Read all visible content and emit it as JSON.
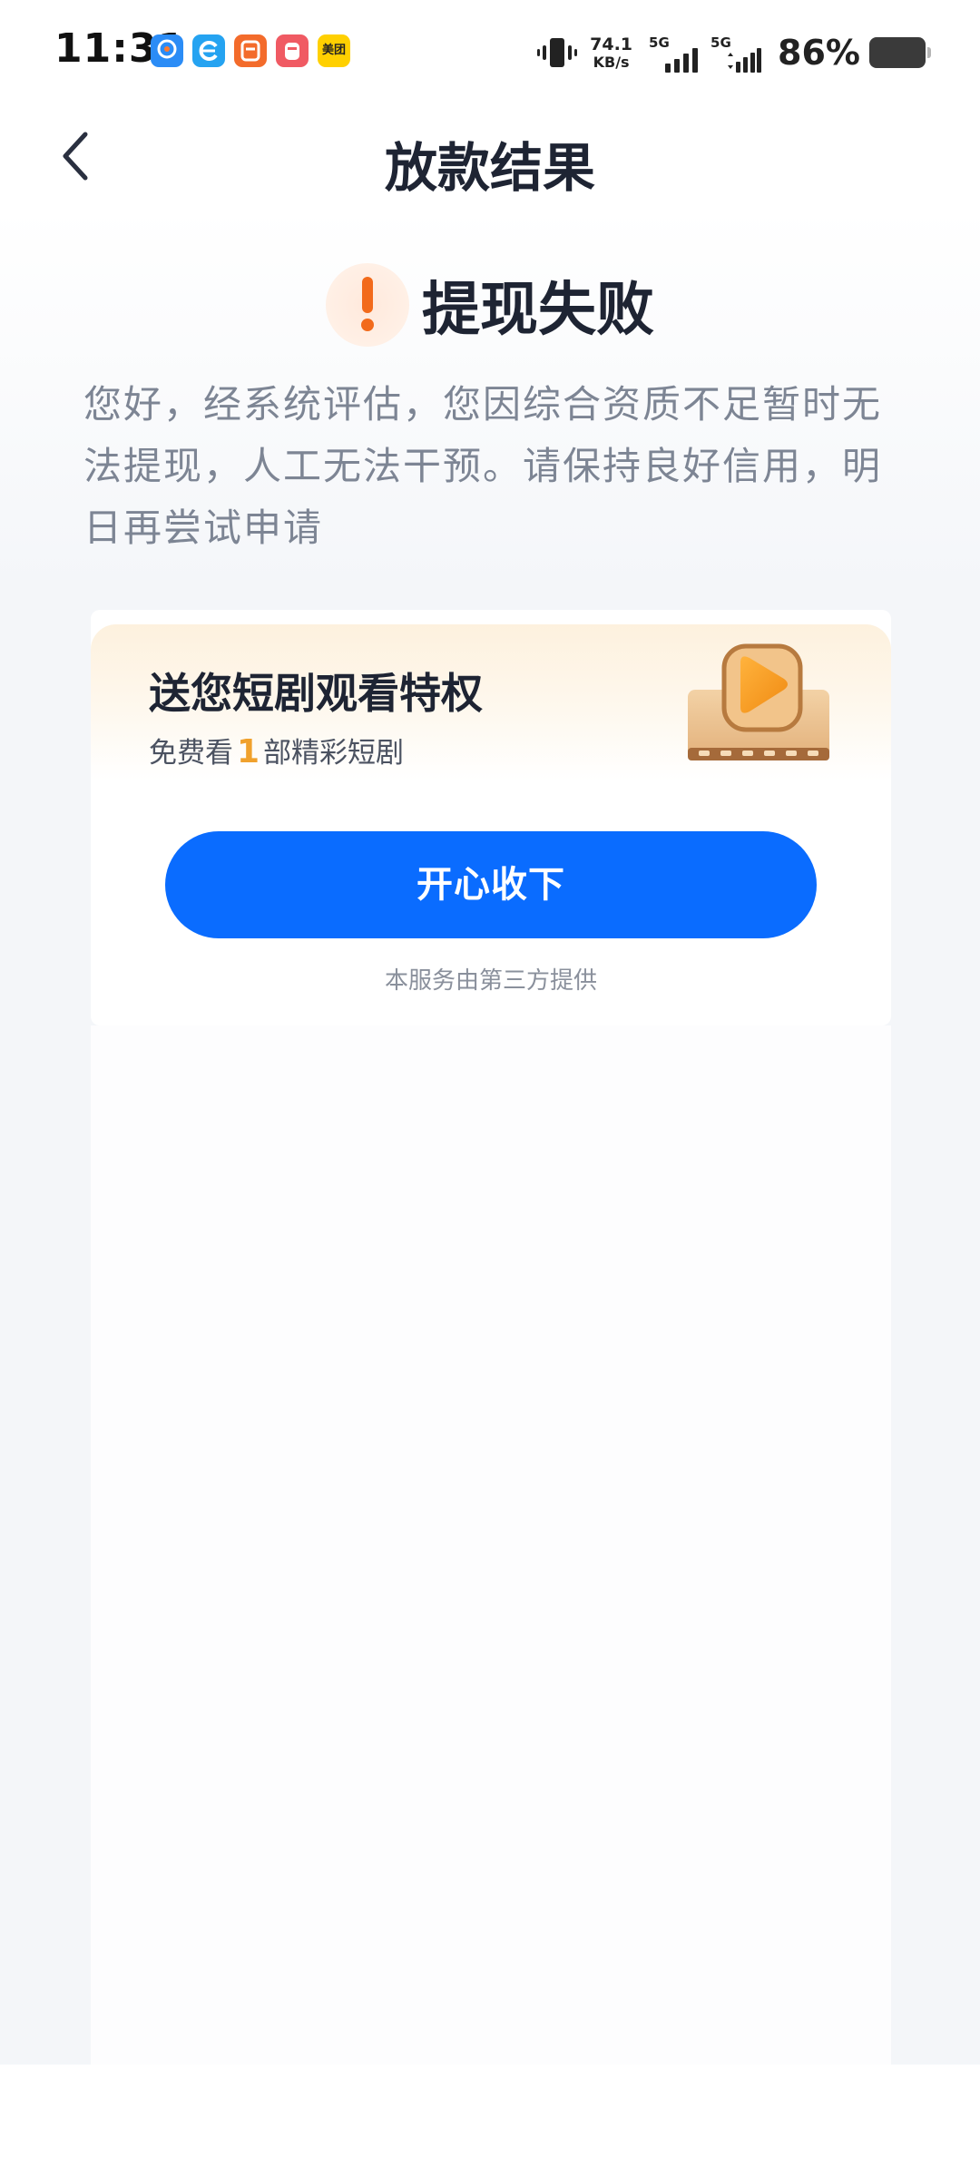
{
  "status_bar": {
    "time": "11:31",
    "net_speed_value": "74.1",
    "net_speed_unit": "KB/s",
    "signal1_label": "5G",
    "signal2_label": "5G",
    "battery": "86%",
    "app_icons": [
      {
        "name": "app-icon-1",
        "color": "#2b8cf6"
      },
      {
        "name": "app-icon-2",
        "color": "#25a3f1"
      },
      {
        "name": "app-icon-3",
        "color": "#f36b2b"
      },
      {
        "name": "app-icon-4",
        "color": "#f05a63"
      },
      {
        "name": "meituan-icon",
        "color": "#ffd000",
        "label": "美团"
      }
    ]
  },
  "nav": {
    "title": "放款结果",
    "back_icon": "chevron-left-icon"
  },
  "result": {
    "icon": "warning-icon",
    "title": "提现失败",
    "message": "您好，经系统评估，您因综合资质不足暂时无法提现，人工无法干预。请保持良好信用，明日再尝试申请"
  },
  "promo": {
    "title": "送您短剧观看特权",
    "subtitle_prefix": "免费看",
    "subtitle_count": "1",
    "subtitle_suffix": "部精彩短剧",
    "icon": "film-play-icon",
    "button_label": "开心收下",
    "provider_note": "本服务由第三方提供",
    "accent_color": "#0a6cff"
  }
}
